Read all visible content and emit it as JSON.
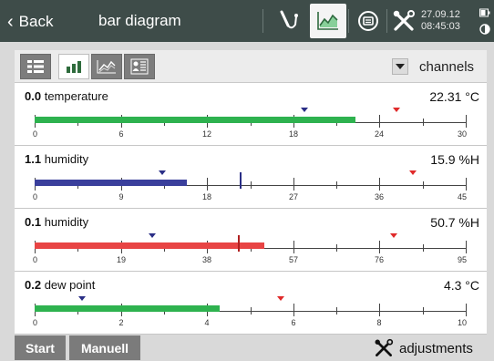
{
  "header": {
    "back_label": "Back",
    "title": "bar diagram",
    "date": "27.09.12",
    "time": "08:45:03",
    "icons": [
      "probe-icon",
      "chart-icon",
      "logger-icon",
      "tools-icon",
      "status-icon"
    ]
  },
  "toolbar": {
    "tabs": [
      "list-view-icon",
      "bar-view-icon",
      "line-view-icon",
      "profile-view-icon"
    ],
    "selected_tab": "bar-view-icon",
    "dropdown_label": "channels"
  },
  "channels": [
    {
      "id": "0.0",
      "name": "temperature",
      "value": "22.31 °C",
      "ticks": [
        "0",
        "6",
        "12",
        "18",
        "24",
        "30"
      ],
      "bar_value": 22.31,
      "min": 0,
      "max": 30,
      "color": "#2eb24f",
      "low_marker": 18.8,
      "high_marker": 25.2,
      "cursor": null
    },
    {
      "id": "1.1",
      "name": "humidity",
      "value": "15.9 %H",
      "ticks": [
        "0",
        "9",
        "18",
        "27",
        "36",
        "45"
      ],
      "bar_value": 15.9,
      "min": 0,
      "max": 45,
      "color": "#3a3f9c",
      "low_marker": 13.3,
      "high_marker": 39.5,
      "cursor": 21.4
    },
    {
      "id": "0.1",
      "name": "humidity",
      "value": "50.7 %H",
      "ticks": [
        "0",
        "19",
        "38",
        "57",
        "76",
        "95"
      ],
      "bar_value": 50.7,
      "min": 0,
      "max": 95,
      "color": "#e84444",
      "low_marker": 26.0,
      "high_marker": 79.2,
      "cursor": 44.7
    },
    {
      "id": "0.2",
      "name": "dew point",
      "value": "4.3 °C",
      "ticks": [
        "0",
        "2",
        "4",
        "6",
        "8",
        "10"
      ],
      "bar_value": 4.3,
      "min": 0,
      "max": 10,
      "color": "#2eb24f",
      "low_marker": 1.1,
      "high_marker": 5.7,
      "cursor": null
    }
  ],
  "footer": {
    "start_label": "Start",
    "manual_label": "Manuell",
    "adjustments_label": "adjustments"
  },
  "colors": {
    "header_bg": "#3e4c49",
    "marker_low": "#2a2e86",
    "marker_high": "#e02a2a"
  }
}
